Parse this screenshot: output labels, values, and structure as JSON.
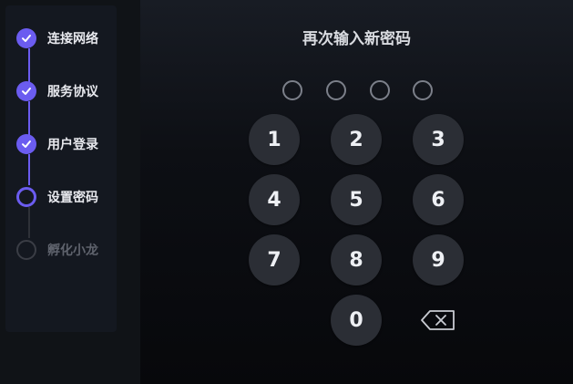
{
  "steps": [
    {
      "label": "连接网络",
      "status": "done"
    },
    {
      "label": "服务协议",
      "status": "done"
    },
    {
      "label": "用户登录",
      "status": "done"
    },
    {
      "label": "设置密码",
      "status": "current"
    },
    {
      "label": "孵化小龙",
      "status": "pending"
    }
  ],
  "pin": {
    "title": "再次输入新密码",
    "entered_count": 0,
    "length": 4
  },
  "keypad": {
    "k1": "1",
    "k2": "2",
    "k3": "3",
    "k4": "4",
    "k5": "5",
    "k6": "6",
    "k7": "7",
    "k8": "8",
    "k9": "9",
    "k0": "0",
    "backspace_icon": "backspace-icon"
  },
  "colors": {
    "accent": "#6b5cf0",
    "key_bg": "#2b2e35"
  }
}
